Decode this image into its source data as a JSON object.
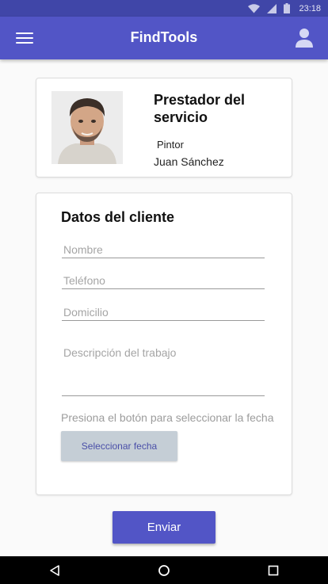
{
  "status_bar": {
    "time": "23:18"
  },
  "app_bar": {
    "title": "FindTools"
  },
  "provider": {
    "title": "Prestador del servicio",
    "role": "Pintor",
    "name": "Juan Sánchez"
  },
  "client_form": {
    "title": "Datos del cliente",
    "name_placeholder": "Nombre",
    "phone_placeholder": "Teléfono",
    "address_placeholder": "Domicilio",
    "description_placeholder": "Descripción del trabajo",
    "date_hint": "Presiona el botón para seleccionar la fecha",
    "date_button_label": "Seleccionar fecha"
  },
  "submit_label": "Enviar",
  "colors": {
    "primary": "#5255c6",
    "status_bar": "#4046a8",
    "date_button_bg": "#c5ced6"
  },
  "icons": [
    "menu-icon",
    "account-icon",
    "wifi-icon",
    "signal-icon",
    "battery-icon",
    "back-icon",
    "home-icon",
    "recents-icon"
  ]
}
